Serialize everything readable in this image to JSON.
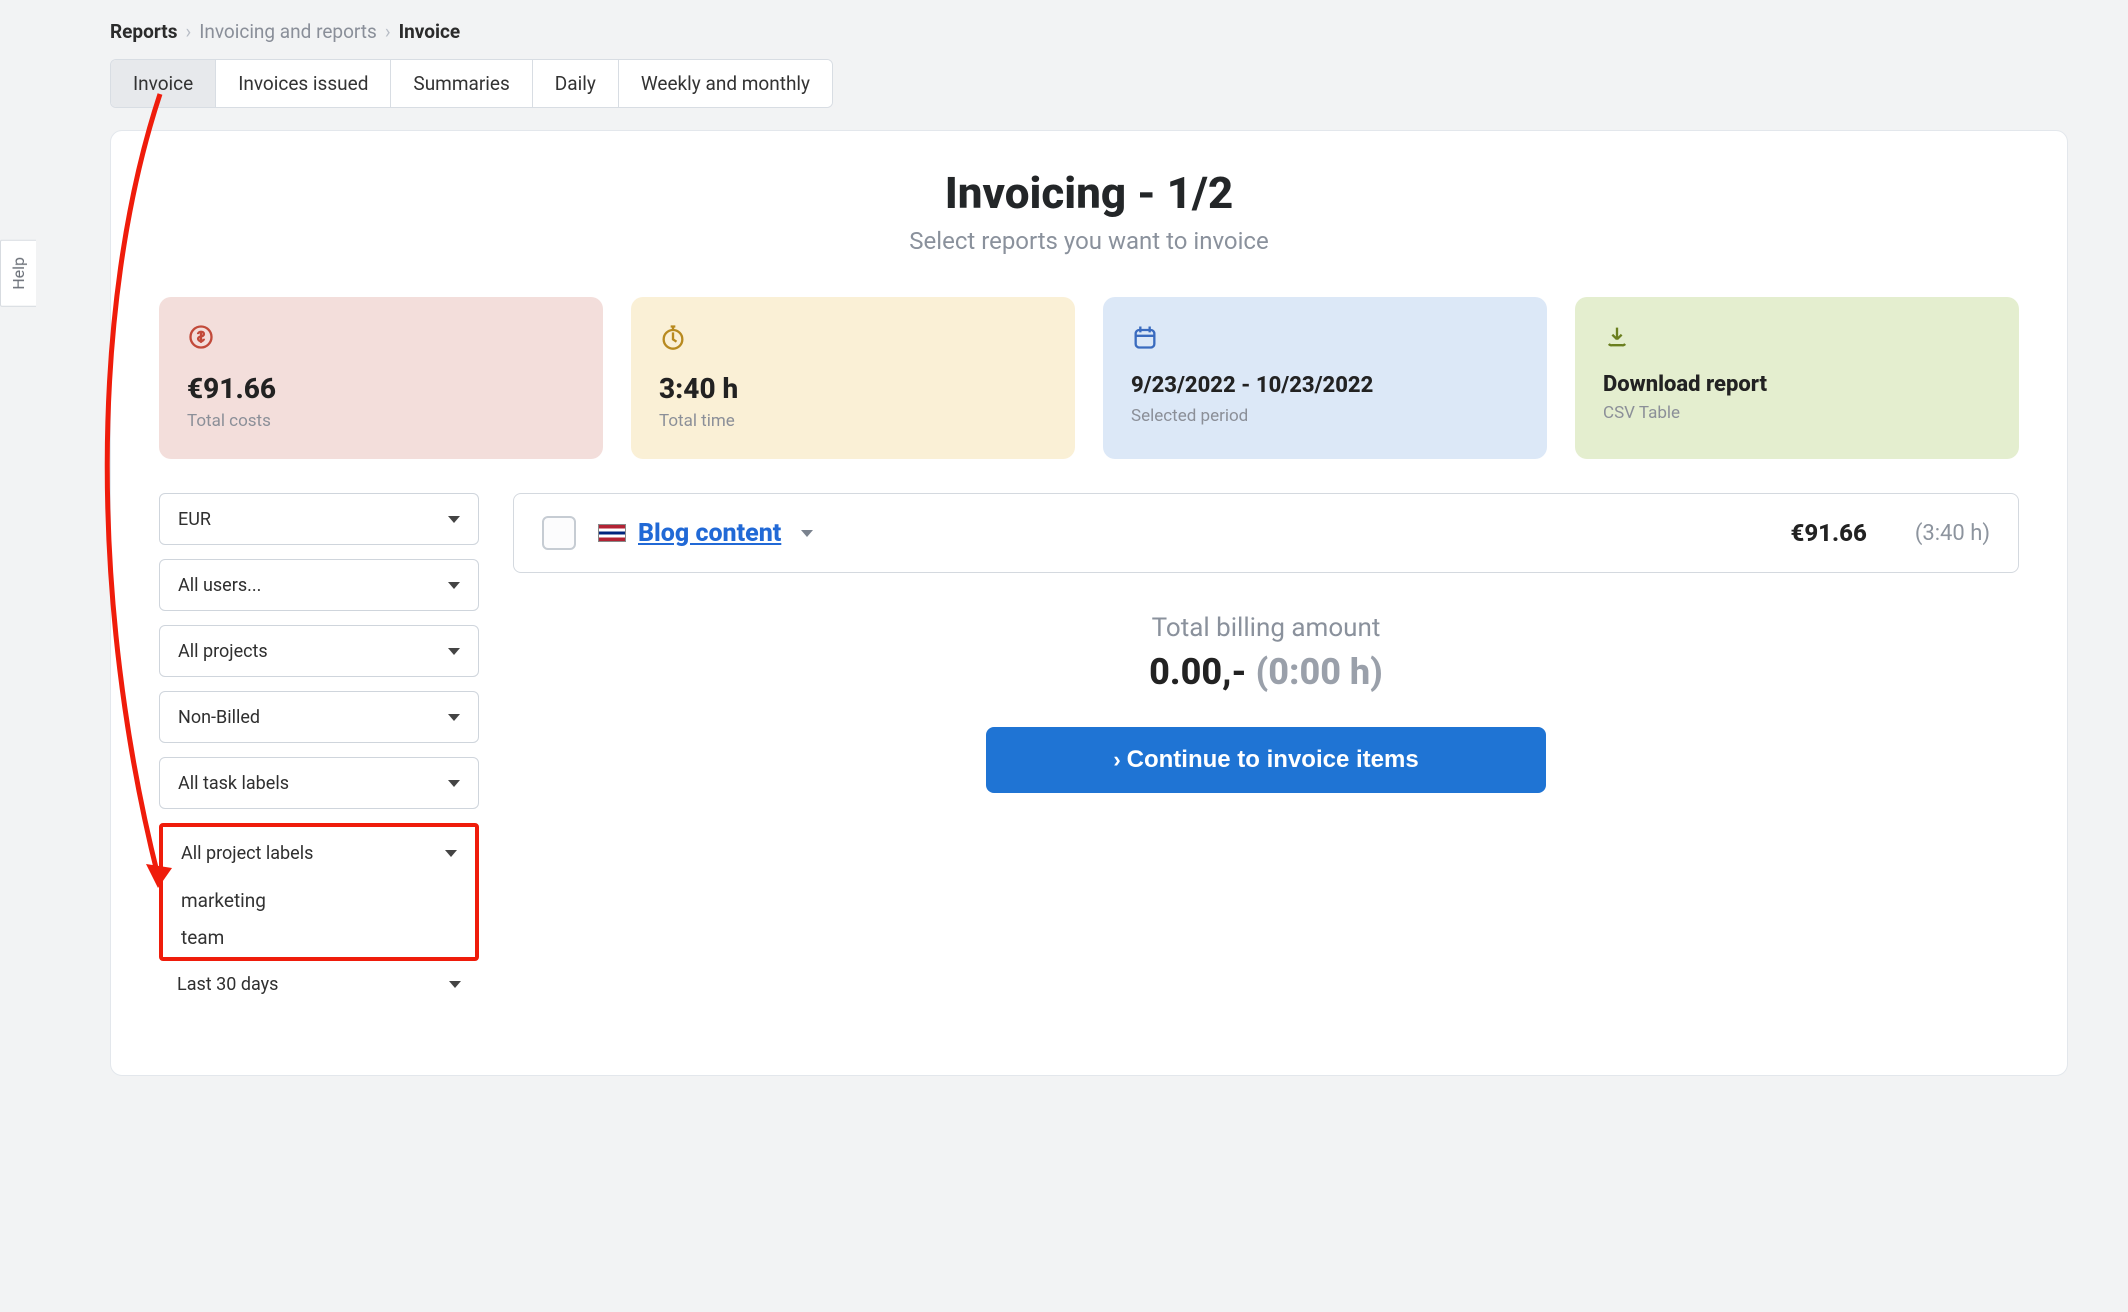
{
  "breadcrumb": {
    "root": "Reports",
    "mid": "Invoicing and reports",
    "current": "Invoice"
  },
  "tabs": [
    {
      "label": "Invoice",
      "active": true
    },
    {
      "label": "Invoices issued",
      "active": false
    },
    {
      "label": "Summaries",
      "active": false
    },
    {
      "label": "Daily",
      "active": false
    },
    {
      "label": "Weekly and monthly",
      "active": false
    }
  ],
  "header": {
    "title": "Invoicing - 1/2",
    "subtitle": "Select reports you want to invoice"
  },
  "stats": {
    "costs": {
      "value": "€91.66",
      "label": "Total costs"
    },
    "time": {
      "value": "3:40 h",
      "label": "Total time"
    },
    "period": {
      "value": "9/23/2022 - 10/23/2022",
      "label": "Selected period"
    },
    "download": {
      "value": "Download report",
      "label": "CSV Table"
    }
  },
  "filters": {
    "currency": "EUR",
    "users": "All users...",
    "projects": "All projects",
    "billed": "Non-Billed",
    "task_labels": "All task labels",
    "project_labels": {
      "selected": "All project labels",
      "options": [
        "marketing",
        "team"
      ]
    },
    "date_range": "Last 30 days"
  },
  "report": {
    "name": "Blog content",
    "flag": "uk",
    "amount": "€91.66",
    "time": "(3:40 h)"
  },
  "billing": {
    "label": "Total billing amount",
    "amount": "0.00,-",
    "time": "(0:00 h)"
  },
  "buttons": {
    "continue": "Continue to invoice items"
  },
  "help_tab": "Help",
  "icons": {
    "costs": "dollar-circle-icon",
    "time": "stopwatch-icon",
    "period": "calendar-icon",
    "download": "download-icon"
  },
  "colors": {
    "brand_blue": "#1f74d4",
    "annotation_red": "#ef1c0b"
  }
}
